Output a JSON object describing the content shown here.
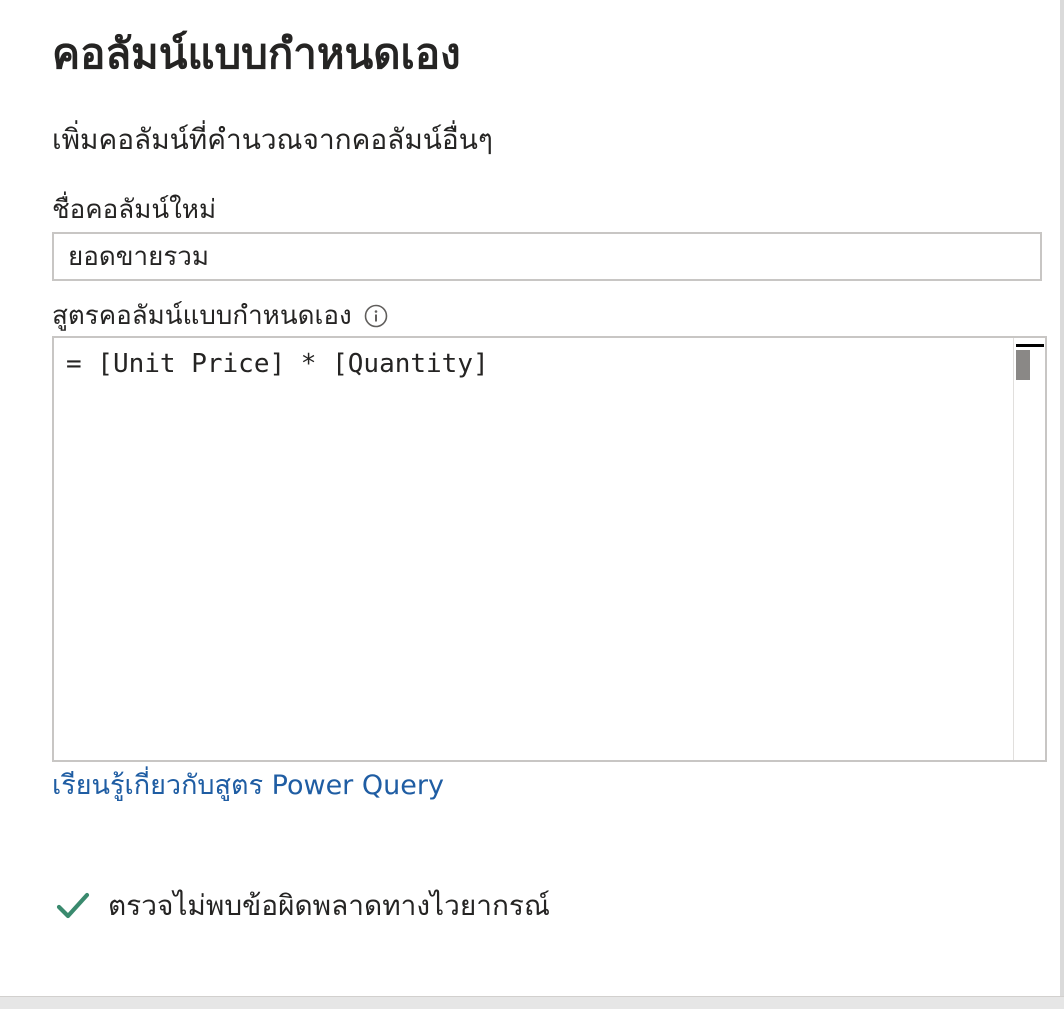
{
  "dialog": {
    "title": "คอลัมน์แบบกำหนดเอง",
    "description": "เพิ่มคอลัมน์ที่คำนวณจากคอลัมน์อื่นๆ"
  },
  "column_name": {
    "label": "ชื่อคอลัมน์ใหม่",
    "value": "ยอดขายรวม"
  },
  "formula": {
    "label": "สูตรคอลัมน์แบบกำหนดเอง",
    "info_icon": "info-icon",
    "value": "= [Unit Price] * [Quantity]"
  },
  "learn_link": {
    "label": "เรียนรู้เกี่ยวกับสูตร Power Query"
  },
  "status": {
    "icon": "checkmark-icon",
    "icon_color": "#3a8a6e",
    "text": "ตรวจไม่พบข้อผิดพลาดทางไวยากรณ์"
  },
  "colors": {
    "link": "#1f5da3",
    "text": "#252423",
    "border": "#c8c6c4"
  }
}
